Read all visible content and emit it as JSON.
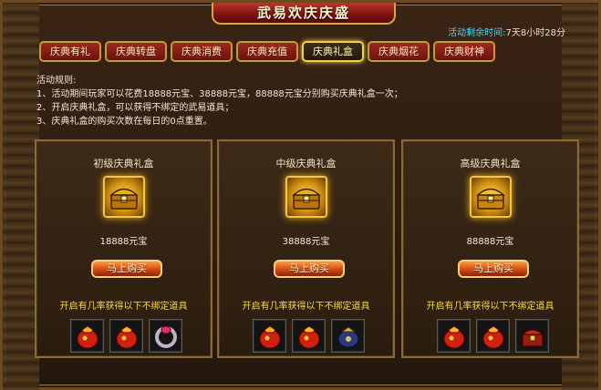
{
  "window": {
    "title": "武易欢庆庆盛"
  },
  "timer": {
    "label": "活动剩余时间:",
    "value": "7天8小时28分"
  },
  "tabs": [
    {
      "label": "庆典有礼",
      "active": false
    },
    {
      "label": "庆典转盘",
      "active": false
    },
    {
      "label": "庆典消费",
      "active": false
    },
    {
      "label": "庆典充值",
      "active": false
    },
    {
      "label": "庆典礼盒",
      "active": true
    },
    {
      "label": "庆典烟花",
      "active": false
    },
    {
      "label": "庆典财神",
      "active": false
    }
  ],
  "rules": {
    "heading": "活动规则:",
    "lines": [
      "1、活动期间玩家可以花费18888元宝、38888元宝，88888元宝分别购买庆典礼盒一次；",
      "2、开启庆典礼盒，可以获得不绑定的武易道具；",
      "3、庆典礼盒的购买次数在每日的0点重置。"
    ]
  },
  "cards": [
    {
      "title": "初级庆典礼盒",
      "price": "18888元宝",
      "button": "马上购买",
      "loot_text": "开启有几率获得以下不绑定道具",
      "items": [
        "red-bag-icon",
        "red-bag-icon",
        "ring-icon"
      ]
    },
    {
      "title": "中级庆典礼盒",
      "price": "38888元宝",
      "button": "马上购买",
      "loot_text": "开启有几率获得以下不绑定道具",
      "items": [
        "red-bag-icon",
        "red-bag-icon",
        "blue-pouch-icon"
      ]
    },
    {
      "title": "高级庆典礼盒",
      "price": "88888元宝",
      "button": "马上购买",
      "loot_text": "开启有几率获得以下不绑定道具",
      "items": [
        "red-bag-icon",
        "red-bag-icon",
        "treasure-chest-icon"
      ]
    }
  ],
  "colors": {
    "frame_gold": "#c69840",
    "tab_red": "#9c2a1e",
    "timer_label": "#4ad8ff",
    "loot_text": "#ffd840"
  }
}
